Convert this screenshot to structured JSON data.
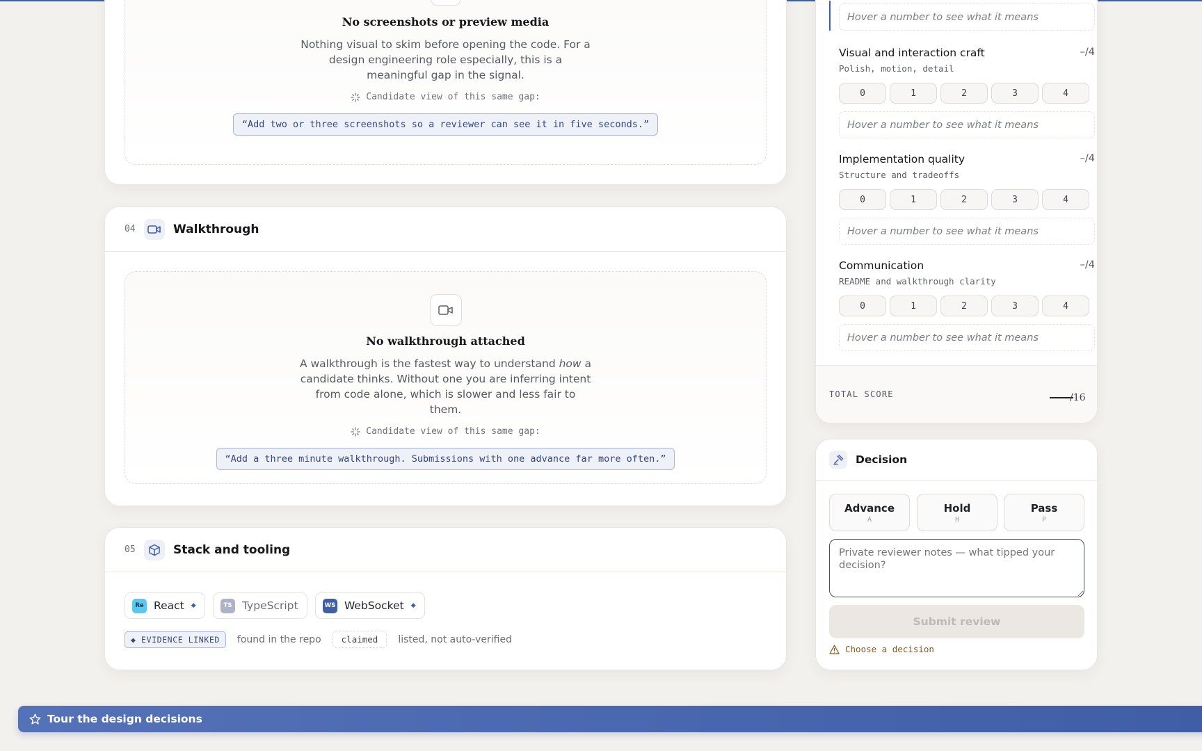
{
  "screenshots_section": {
    "title": "No screenshots or preview media",
    "description": "Nothing visual to skim before opening the code. For a design engineering role especially, this is a meaningful gap in the signal.",
    "candidate_label": "Candidate view of this same gap:",
    "candidate_quote": "“Add two or three screenshots so a reviewer can see it in five seconds.”"
  },
  "walkthrough_section": {
    "number": "04",
    "title": "Walkthrough",
    "empty_title": "No walkthrough attached",
    "desc_before": "A walkthrough is the fastest way to understand ",
    "desc_em": "how",
    "desc_after": " a candidate thinks. Without one you are inferring intent from code alone, which is slower and less fair to them.",
    "candidate_label": "Candidate view of this same gap:",
    "candidate_quote": "“Add a three minute walkthrough. Submissions with one advance far more often.”"
  },
  "stack_section": {
    "number": "05",
    "title": "Stack and tooling",
    "chips": [
      {
        "logo": "Re",
        "name": "React",
        "linked": true,
        "logo_color": "#5bc8ef"
      },
      {
        "logo": "TS",
        "name": "TypeScript",
        "linked": false,
        "logo_color": "#aab3c7"
      },
      {
        "logo": "WS",
        "name": "WebSocket",
        "linked": true,
        "logo_color": "#3f5fa8"
      }
    ],
    "legend": {
      "linked_badge": "◆ EVIDENCE LINKED",
      "linked_text": "found in the repo",
      "claimed_badge": "claimed",
      "claimed_text": "listed, not auto-verified"
    }
  },
  "rubric": {
    "top_hint": "Hover a number to see what it means",
    "criteria": [
      {
        "name": "Visual and interaction craft",
        "score": "–/4",
        "sub": "Polish, motion, detail",
        "options": [
          "0",
          "1",
          "2",
          "3",
          "4"
        ],
        "hint": "Hover a number to see what it means"
      },
      {
        "name": "Implementation quality",
        "score": "–/4",
        "sub": "Structure and tradeoffs",
        "options": [
          "0",
          "1",
          "2",
          "3",
          "4"
        ],
        "hint": "Hover a number to see what it means"
      },
      {
        "name": "Communication",
        "score": "–/4",
        "sub": "README and walkthrough clarity",
        "options": [
          "0",
          "1",
          "2",
          "3",
          "4"
        ],
        "hint": "Hover a number to see what it means"
      }
    ],
    "total_label": "TOTAL SCORE",
    "total_max": "/16"
  },
  "decision": {
    "title": "Decision",
    "buttons": [
      {
        "label": "Advance",
        "key": "A"
      },
      {
        "label": "Hold",
        "key": "H"
      },
      {
        "label": "Pass",
        "key": "P"
      }
    ],
    "notes_placeholder": "Private reviewer notes — what tipped your decision?",
    "submit_label": "Submit review",
    "warning": "Choose a decision"
  },
  "tour": {
    "label": "Tour the design decisions"
  },
  "colors": {
    "accent": "#3f5fa8",
    "warning": "#8a5a1c"
  }
}
